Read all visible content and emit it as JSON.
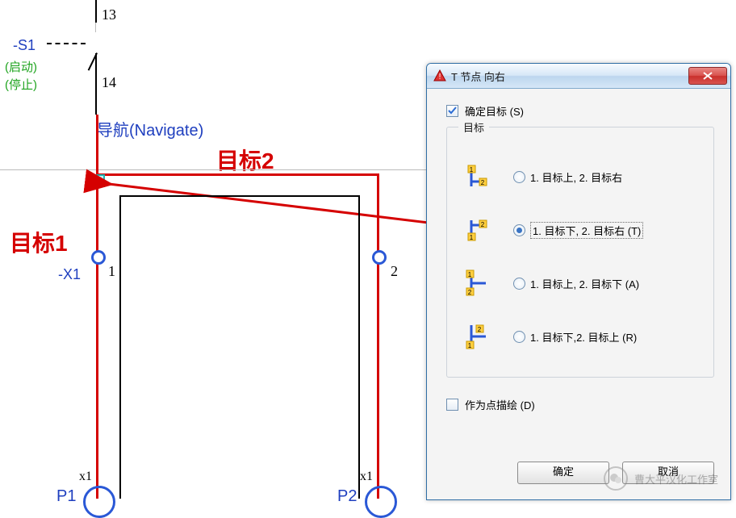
{
  "schematic": {
    "s1": "-S1",
    "start": "(启动)",
    "stop": "(停止)",
    "n13": "13",
    "n14": "14",
    "navigate": "导航(Navigate)",
    "target1": "目标1",
    "target2": "目标2",
    "x1_label": "-X1",
    "x1_pin1": "1",
    "x1_pin2": "2",
    "conn_x1_a": "x1",
    "conn_x1_b": "x1",
    "p1": "P1",
    "p2": "P2"
  },
  "dialog": {
    "title": "T 节点 向右",
    "determine_target": "确定目标 (S)",
    "determine_target_checked": true,
    "group_label": "目标",
    "options": [
      {
        "label": "1. 目标上, 2. 目标右",
        "selected": false
      },
      {
        "label": "1. 目标下, 2. 目标右 (T)",
        "selected": true
      },
      {
        "label": "1. 目标上, 2. 目标下 (A)",
        "selected": false
      },
      {
        "label": "1. 目标下,2. 目标上 (R)",
        "selected": false
      }
    ],
    "draw_as_point": "作为点描绘 (D)",
    "draw_as_point_checked": false,
    "ok": "确定",
    "cancel": "取消"
  },
  "watermark": "曹大平汉化工作室"
}
